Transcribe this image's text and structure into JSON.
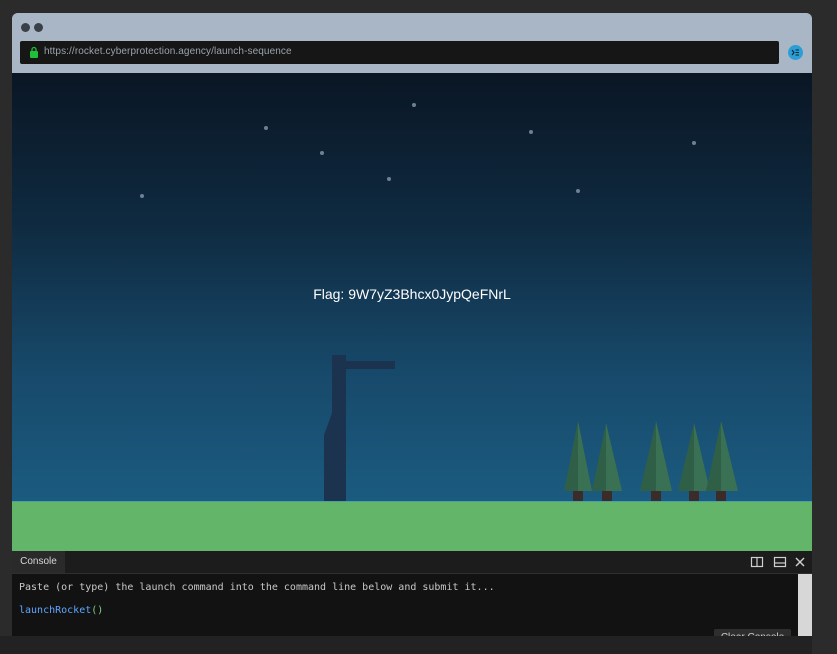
{
  "browser": {
    "url": "https://rocket.cyberprotection.agency/launch-sequence",
    "menu_icon": "list-arrow-icon"
  },
  "scene": {
    "flag_text": "Flag: 9W7yZ3Bhcx0JypQeFNrL"
  },
  "console": {
    "tab_label": "Console",
    "message": "Paste (or type) the launch command into the command line below and submit it...",
    "command_name": "launchRocket",
    "command_parens": "()",
    "clear_label": "Clear Console",
    "icons": [
      "split-panel-icon",
      "dock-bottom-icon",
      "close-icon"
    ]
  },
  "colors": {
    "sky_top": "#0a1624",
    "sky_bottom": "#1b5b80",
    "grass": "#63b56a",
    "tree": "#2f5f47",
    "command": "#5fa6ff",
    "parens": "#7fd17f",
    "accent": "#2b9ed6"
  }
}
